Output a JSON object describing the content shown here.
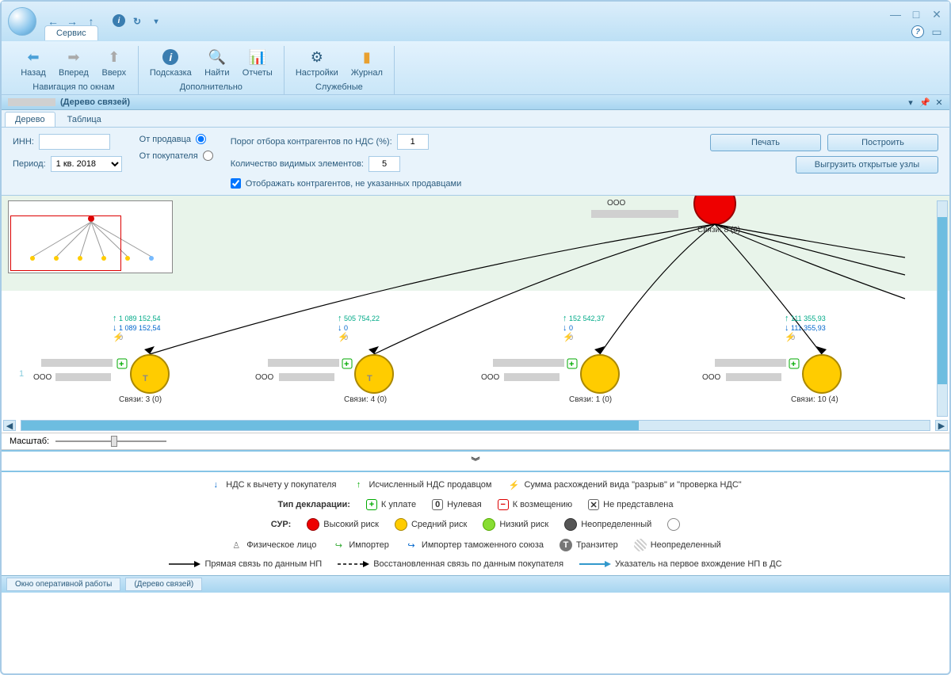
{
  "titlebar": {
    "service_tab": "Сервис"
  },
  "ribbon": {
    "nav": {
      "back": "Назад",
      "forward": "Вперед",
      "up": "Вверх",
      "group": "Навигация по окнам"
    },
    "extra": {
      "hint": "Подсказка",
      "find": "Найти",
      "reports": "Отчеты",
      "group": "Дополнительно"
    },
    "service": {
      "settings": "Настройки",
      "journal": "Журнал",
      "group": "Служебные"
    }
  },
  "panel": {
    "title": "(Дерево связей)"
  },
  "subtabs": {
    "tree": "Дерево",
    "table": "Таблица"
  },
  "filters": {
    "inn_label": "ИНН:",
    "period_label": "Период:",
    "period_value": "1 кв. 2018",
    "from_seller": "От продавца",
    "from_buyer": "От покупателя",
    "threshold_label": "Порог отбора контрагентов по НДС (%):",
    "threshold_value": "1",
    "visible_label": "Количество видимых элементов:",
    "visible_value": "5",
    "checkbox_label": "Отображать контрагентов, не указанных продавцами",
    "print_btn": "Печать",
    "build_btn": "Построить",
    "export_btn": "Выгрузить открытые узлы"
  },
  "diagram": {
    "root": {
      "ooo": "ООО",
      "links": "Связи: 8 (0)"
    },
    "nodes": [
      {
        "ooo": "ООО",
        "links": "Связи: 3 (0)",
        "up": "1 089 152,54",
        "down": "1 089 152,54",
        "flash": "0",
        "letter": "Т"
      },
      {
        "ooo": "ООО",
        "links": "Связи: 4 (0)",
        "up": "505 754,22",
        "down": "0",
        "flash": "0",
        "letter": "Т"
      },
      {
        "ooo": "ООО",
        "links": "Связи: 1 (0)",
        "up": "152 542,37",
        "down": "0",
        "flash": "0",
        "letter": ""
      },
      {
        "ooo": "ООО",
        "links": "Связи: 10 (4)",
        "up": "111 355,93",
        "down": "111 355,93",
        "flash": "0",
        "letter": ""
      }
    ],
    "page_number": "1"
  },
  "zoom": {
    "label": "Масштаб:"
  },
  "legend": {
    "row1": {
      "a": "НДС к вычету у покупателя",
      "b": "Исчисленный НДС продавцом",
      "c": "Сумма расхождений вида \"разрыв\" и \"проверка НДС\""
    },
    "row2": {
      "label": "Тип декларации:",
      "pay": "К уплате",
      "zero": "Нулевая",
      "refund": "К возмещению",
      "none": "Не представлена"
    },
    "row3": {
      "label": "СУР:",
      "high": "Высокий риск",
      "med": "Средний риск",
      "low": "Низкий риск",
      "undef": "Неопределенный"
    },
    "row4": {
      "person": "Физическое лицо",
      "importer": "Импортер",
      "cu_importer": "Импортер таможенного союза",
      "transit": "Транзитер",
      "undef": "Неопределенный"
    },
    "row5": {
      "direct": "Прямая связь по данным НП",
      "restored": "Восстановленная связь по данным покупателя",
      "pointer": "Указатель на первое вхождение НП в ДС"
    }
  },
  "footer": {
    "tab1": "Окно оперативной работы",
    "tab2": "(Дерево связей)"
  }
}
